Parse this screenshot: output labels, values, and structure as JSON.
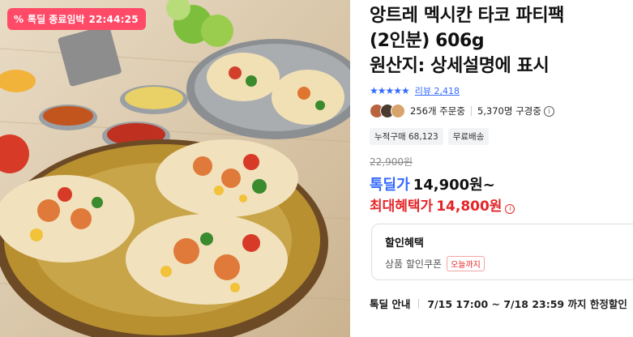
{
  "deal_badge": {
    "icon": "percent-icon",
    "label": "톡딜 종료임박",
    "timer": "22:44:25"
  },
  "product": {
    "title_lines": [
      "앙트레 멕시칸 타코 파티팩",
      "(2인분) 606g",
      "원산지: 상세설명에 표시"
    ],
    "rating_stars": "★★★★★",
    "review_label": "리뷰 2,418",
    "orders": "256개 주문중",
    "subscribers": "5,370명 구경중",
    "tags": [
      "누적구매 68,123",
      "무료배송"
    ]
  },
  "pricing": {
    "original": "22,900원",
    "deal_label": "톡딜가",
    "deal_price": "14,900원~",
    "max_label": "최대혜택가",
    "max_price": "14,800원"
  },
  "discount": {
    "title": "할인혜택",
    "coupon_label": "상품 할인쿠폰",
    "coupon_badge": "오늘까지"
  },
  "notice": {
    "label": "톡딜 안내",
    "text": "7/15 17:00 ~ 7/18 23:59 까지 한정할인"
  },
  "colors": {
    "accent_blue": "#346aff",
    "accent_red": "#e52528",
    "badge_pink": "#ff4a68"
  }
}
